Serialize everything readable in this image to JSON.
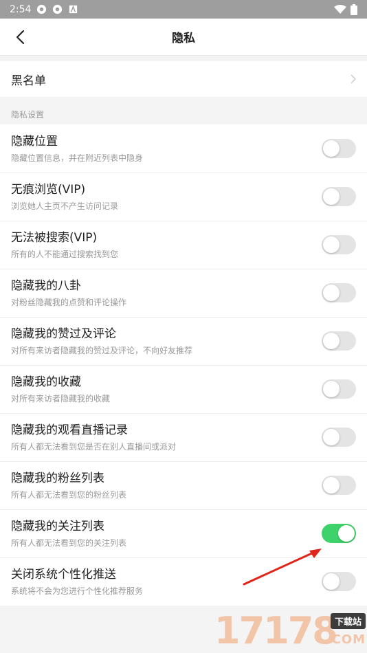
{
  "status_bar": {
    "time": "2:54",
    "icons": [
      "app-icon",
      "app-icon",
      "notification-icon"
    ],
    "right_icons": [
      "wifi-icon",
      "battery-icon"
    ]
  },
  "nav": {
    "title": "隐私",
    "back_icon": "back-arrow-icon"
  },
  "blacklist": {
    "label": "黑名单",
    "chevron_icon": "chevron-right-icon"
  },
  "section": {
    "header": "隐私设置"
  },
  "settings": [
    {
      "title": "隐藏位置",
      "subtitle": "隐藏位置信息，并在附近列表中隐身",
      "enabled": false
    },
    {
      "title": "无痕浏览(VIP)",
      "subtitle": "浏览她人主页不产生访问记录",
      "enabled": false
    },
    {
      "title": "无法被搜索(VIP)",
      "subtitle": "所有的人不能通过搜索找到您",
      "enabled": false
    },
    {
      "title": "隐藏我的八卦",
      "subtitle": "对粉丝隐藏我的点赞和评论操作",
      "enabled": false
    },
    {
      "title": "隐藏我的赞过及评论",
      "subtitle": "对所有来访者隐藏我的赞过及评论，不向好友推荐",
      "enabled": false
    },
    {
      "title": "隐藏我的收藏",
      "subtitle": "对所有来访者隐藏我的收藏",
      "enabled": false
    },
    {
      "title": "隐藏我的观看直播记录",
      "subtitle": "所有人都无法看到您是否在别人直播间或派对",
      "enabled": false
    },
    {
      "title": "隐藏我的粉丝列表",
      "subtitle": "所有人都无法看到您的粉丝列表",
      "enabled": false
    },
    {
      "title": "隐藏我的关注列表",
      "subtitle": "所有人都无法看到您的关注列表",
      "enabled": true
    },
    {
      "title": "关闭系统个性化推送",
      "subtitle": "系统将不会为您进行个性化推荐服务",
      "enabled": false
    }
  ],
  "colors": {
    "toggle_on": "#3ed36a",
    "toggle_off": "#e4e4e4",
    "annotation_arrow": "#e0251b"
  },
  "watermark": {
    "digits": "17178",
    "badge": "下载站",
    "suffix": "COM"
  }
}
